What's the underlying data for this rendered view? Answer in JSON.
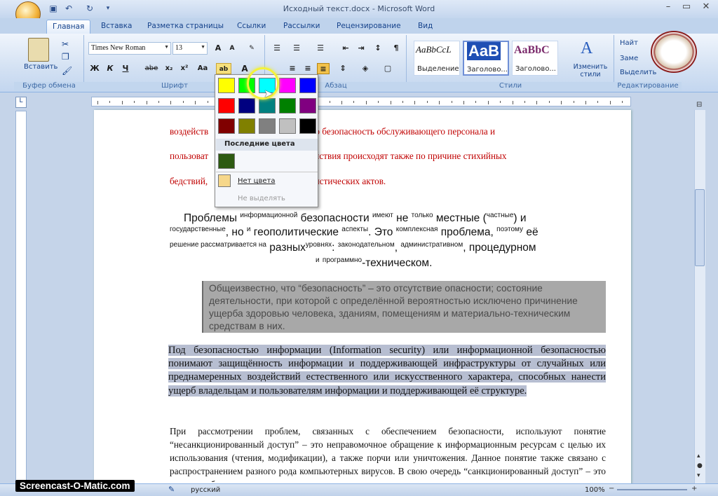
{
  "window": {
    "title": "Исходный текст.docx - Microsoft Word"
  },
  "tabs": [
    "Главная",
    "Вставка",
    "Разметка страницы",
    "Ссылки",
    "Рассылки",
    "Рецензирование",
    "Вид"
  ],
  "ribbon": {
    "clipboard": {
      "paste_label": "Вставить",
      "group_label": "Буфер обмена"
    },
    "font": {
      "name": "Times New Roman",
      "size": "13",
      "group_label": "Шрифт",
      "bold": "Ж",
      "italic": "К",
      "underline": "Ч",
      "strike": "abe",
      "sub": "x₂",
      "sup": "x²",
      "case": "Аа"
    },
    "paragraph": {
      "group_label": "Абзац"
    },
    "styles": {
      "group_label": "Стили",
      "items": [
        {
          "sample": "AaBbCcL",
          "label": "Выделение"
        },
        {
          "sample": "AaB",
          "label": "Заголово..."
        },
        {
          "sample": "AaBbC",
          "label": "Заголово..."
        }
      ],
      "change_label": "Изменить стили"
    },
    "editing": {
      "group_label": "Редактирование",
      "find": "Найт",
      "replace": "Заме",
      "select": "Выделить"
    }
  },
  "color_menu": {
    "recent_label": "Последние цвета",
    "no_color_label": "Нет цвета",
    "stop_label": "Не выделять",
    "swatches": [
      "#ffff00",
      "#00ff00",
      "#00ffff",
      "#ff00ff",
      "#0000ff",
      "#ff0000",
      "#000080",
      "#008080",
      "#008000",
      "#800080",
      "#800000",
      "#808000",
      "#808080",
      "#c0c0c0",
      "#000000"
    ],
    "recent": "#2d5a12",
    "no_color": "#f6d78a"
  },
  "document": {
    "red_lines": [
      "воздейств                         ения, личную безопасность обслуживающего персонала и",
      "пользоват                       добные воздействия происходят также по причине стихийных",
      "бедствий,                          оф и террористических актов."
    ],
    "mixed": {
      "line1_a": "Проблемы",
      "line1_s1": "информационной",
      "line1_b": "безопасности",
      "line1_s2": "имеют",
      "line1_c": "не",
      "line1_s3": "только",
      "line1_d": "местные (",
      "line1_s4": "частные",
      "line1_e": ") и",
      "line2_s1": "государственные",
      "line2_a": ", но",
      "line2_s2": "и",
      "line2_b": "геополитические",
      "line2_s3": "аспекты",
      "line2_c": ". Это",
      "line2_s4": "комплексная",
      "line2_d": "проблема,",
      "line2_s5": "поэтому",
      "line2_e": "её",
      "line3_s1": "решение рассматривается на",
      "line3_a": "разных",
      "line3_s2": "уровнях",
      "line3_b": ":",
      "line3_s3": "законодательном",
      "line3_c": ",",
      "line3_s4": "административном",
      "line3_d": ", процедурном",
      "line4_s1": "и",
      "line4_s2": "программно",
      "line4_a": "-техническом."
    },
    "gray_block": "Общеизвестно, что “безопасность” – это отсутствие опасности; состояние деятельности, при которой с определённой вероятностью исключено причинение ущерба здоровью человека, зданиям, помещениям и материально-техническим средствам в них.",
    "selected_block": "Под безопасностью информации (Information security) или информационной безопасностью понимают защищённость информации и поддерживающей инфраструктуры от случайных или преднамеренных воздействий естественного или искусственного характера, способных нанести ущерб владельцам и пользователям информации и поддерживающей её структуре.",
    "last_block": "При рассмотрении проблем, связанных с обеспечением безопасности, используют понятие “несанкционированный доступ” – это неправомочное обращение к информационным ресурсам с целью их использования (чтения, модификации), а также порчи или уничтожения. Данное понятие также связано с распространением разного рода компьютерных вирусов. В свою очередь “санкционированный доступ” – это доступ к объектам, программам и данным"
  },
  "status": {
    "language": "русский",
    "zoom": "100%"
  },
  "watermark": "Screencast-O-Matic.com"
}
